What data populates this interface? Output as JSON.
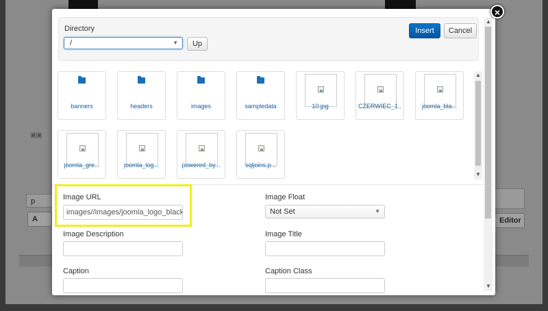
{
  "background": {
    "input_value": "p",
    "left_button_label": "A",
    "right_button_label": "Editor",
    "thumbs": "▣▣"
  },
  "modal": {
    "close_glyph": "×",
    "directory": {
      "label": "Directory",
      "selected": "/",
      "up_label": "Up"
    },
    "actions": {
      "insert_label": "Insert",
      "cancel_label": "Cancel"
    },
    "folders": [
      {
        "name": "banners"
      },
      {
        "name": "headers"
      },
      {
        "name": "images"
      },
      {
        "name": "sampledata"
      }
    ],
    "images": [
      {
        "name": "10.jpg"
      },
      {
        "name": "CZERWIEC_1..."
      },
      {
        "name": "joomla_bla..."
      },
      {
        "name": "joomla_gre..."
      },
      {
        "name": "joomla_log..."
      },
      {
        "name": "powered_by..."
      },
      {
        "name": "sqljoins.p..."
      }
    ],
    "form": {
      "image_url_label": "Image URL",
      "image_url_value": "images//images/joomla_logo_black.j",
      "image_float_label": "Image Float",
      "image_float_value": "Not Set",
      "image_description_label": "Image Description",
      "image_description_value": "",
      "image_title_label": "Image Title",
      "image_title_value": "",
      "caption_label": "Caption",
      "caption_value": "",
      "caption_class_label": "Caption Class",
      "caption_class_value": ""
    }
  },
  "colors": {
    "accent": "#0b74c8",
    "highlight": "#f0ef16",
    "link": "#1a5fa0",
    "folder": "#1a6fb8"
  }
}
